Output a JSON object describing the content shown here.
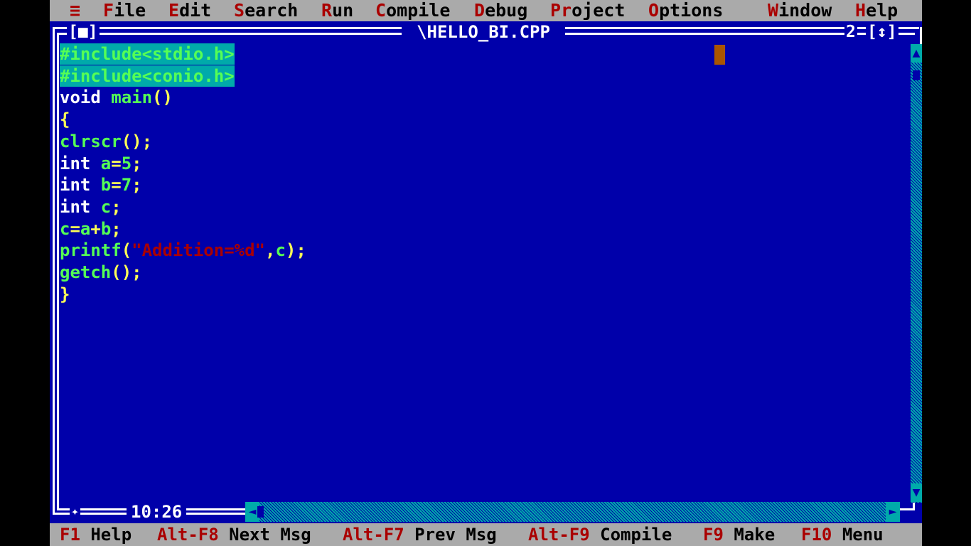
{
  "menu": {
    "system": "≡",
    "items": [
      {
        "hot": "F",
        "rest": "ile"
      },
      {
        "hot": "E",
        "rest": "dit"
      },
      {
        "hot": "S",
        "rest": "earch"
      },
      {
        "hot": "R",
        "rest": "un"
      },
      {
        "hot": "C",
        "rest": "ompile"
      },
      {
        "hot": "D",
        "rest": "ebug"
      },
      {
        "hot": "Pr",
        "rest": "oject"
      },
      {
        "hot": "O",
        "rest": "ptions"
      },
      {
        "hot": "W",
        "rest": "indow"
      },
      {
        "hot": "H",
        "rest": "elp"
      }
    ]
  },
  "window": {
    "title": "\\HELLO_BI.CPP",
    "close_button": "[■]",
    "number": "2",
    "zoom_button": "[↕]",
    "cursor_position": "10:26",
    "size_grip": "✦"
  },
  "code": [
    [
      {
        "t": "#include<stdio.h>",
        "c": "pre"
      }
    ],
    [
      {
        "t": "#include<conio.h>",
        "c": "pre"
      }
    ],
    [
      {
        "t": "void ",
        "c": "kw"
      },
      {
        "t": "main",
        "c": "id"
      },
      {
        "t": "()",
        "c": "sym"
      }
    ],
    [
      {
        "t": "{",
        "c": "sym"
      }
    ],
    [
      {
        "t": "clrscr",
        "c": "id"
      },
      {
        "t": "();",
        "c": "sym"
      }
    ],
    [
      {
        "t": "int ",
        "c": "kw"
      },
      {
        "t": "a",
        "c": "id"
      },
      {
        "t": "=",
        "c": "sym"
      },
      {
        "t": "5",
        "c": "num"
      },
      {
        "t": ";",
        "c": "sym"
      }
    ],
    [
      {
        "t": "int ",
        "c": "kw"
      },
      {
        "t": "b",
        "c": "id"
      },
      {
        "t": "=",
        "c": "sym"
      },
      {
        "t": "7",
        "c": "num"
      },
      {
        "t": ";",
        "c": "sym"
      }
    ],
    [
      {
        "t": "int ",
        "c": "kw"
      },
      {
        "t": "c",
        "c": "id"
      },
      {
        "t": ";",
        "c": "sym"
      }
    ],
    [
      {
        "t": "c",
        "c": "id"
      },
      {
        "t": "=",
        "c": "sym"
      },
      {
        "t": "a",
        "c": "id"
      },
      {
        "t": "+",
        "c": "sym"
      },
      {
        "t": "b",
        "c": "id"
      },
      {
        "t": ";",
        "c": "sym"
      }
    ],
    [
      {
        "t": "printf",
        "c": "id"
      },
      {
        "t": "(",
        "c": "sym"
      },
      {
        "t": "\"Addition=%d\"",
        "c": "str"
      },
      {
        "t": ",",
        "c": "sym"
      },
      {
        "t": "c",
        "c": "id"
      },
      {
        "t": ");",
        "c": "sym"
      }
    ],
    [
      {
        "t": "getch",
        "c": "id"
      },
      {
        "t": "();",
        "c": "sym"
      }
    ],
    [
      {
        "t": "}",
        "c": "sym"
      }
    ]
  ],
  "status": [
    {
      "key": "F1",
      "label": "Help"
    },
    {
      "key": "Alt-F8",
      "label": "Next Msg"
    },
    {
      "key": "Alt-F7",
      "label": "Prev Msg"
    },
    {
      "key": "Alt-F9",
      "label": "Compile"
    },
    {
      "key": "F9",
      "label": "Make"
    },
    {
      "key": "F10",
      "label": "Menu"
    }
  ],
  "colors": {
    "background": "#0000AA",
    "menu_bar": "#AAAAAA",
    "hotkey": "#AA0000",
    "selection": "#00AAAA",
    "cursor_block": "#AA5500"
  }
}
